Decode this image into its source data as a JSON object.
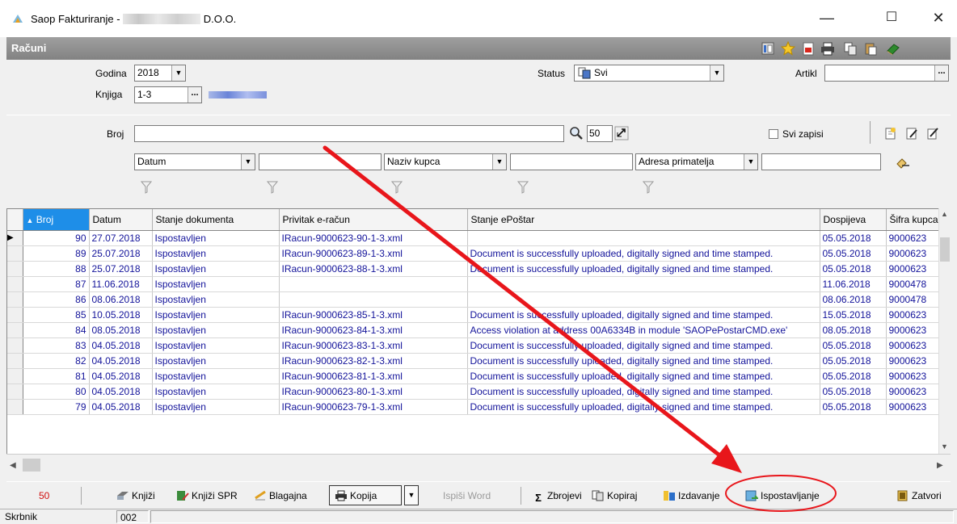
{
  "window": {
    "app_title": "Saop Fakturiranje - ",
    "company_suffix": " D.O.O.",
    "minimize": "—",
    "maximize": "☐",
    "close": "✕"
  },
  "caption": {
    "title": "Računi"
  },
  "filters": {
    "godina_label": "Godina",
    "godina_value": "2018",
    "knjiga_label": "Knjiga",
    "knjiga_value": "1-3",
    "status_label": "Status",
    "status_value": "Svi",
    "artikl_label": "Artikl",
    "artikl_value": "",
    "broj_label": "Broj",
    "broj_value": "",
    "limit_value": "50",
    "svi_zapisi_label": "Svi zapisi",
    "filter1_field": "Datum",
    "filter2_field": "Naziv kupca",
    "filter3_field": "Adresa primatelja"
  },
  "table": {
    "columns": [
      "Broj",
      "Datum",
      "Stanje dokumenta",
      "Privitak e-račun",
      "Stanje ePoštar",
      "Dospijeva",
      "Šifra kupca"
    ],
    "rows": [
      [
        "90",
        "27.07.2018",
        "Ispostavljen",
        "IRacun-9000623-90-1-3.xml",
        "",
        "05.05.2018",
        "9000623"
      ],
      [
        "89",
        "25.07.2018",
        "Ispostavljen",
        "IRacun-9000623-89-1-3.xml",
        "Document is successfully uploaded, digitally signed and time stamped.",
        "05.05.2018",
        "9000623"
      ],
      [
        "88",
        "25.07.2018",
        "Ispostavljen",
        "IRacun-9000623-88-1-3.xml",
        "Document is successfully uploaded, digitally signed and time stamped.",
        "05.05.2018",
        "9000623"
      ],
      [
        "87",
        "11.06.2018",
        "Ispostavljen",
        "",
        "",
        "11.06.2018",
        "9000478"
      ],
      [
        "86",
        "08.06.2018",
        "Ispostavljen",
        "",
        "",
        "08.06.2018",
        "9000478"
      ],
      [
        "85",
        "10.05.2018",
        "Ispostavljen",
        "IRacun-9000623-85-1-3.xml",
        "Document is successfully uploaded, digitally signed and time stamped.",
        "15.05.2018",
        "9000623"
      ],
      [
        "84",
        "08.05.2018",
        "Ispostavljen",
        "IRacun-9000623-84-1-3.xml",
        "Access violation at address 00A6334B in module 'SAOPePostarCMD.exe'",
        "08.05.2018",
        "9000623"
      ],
      [
        "83",
        "04.05.2018",
        "Ispostavljen",
        "IRacun-9000623-83-1-3.xml",
        "Document is successfully uploaded, digitally signed and time stamped.",
        "05.05.2018",
        "9000623"
      ],
      [
        "82",
        "04.05.2018",
        "Ispostavljen",
        "IRacun-9000623-82-1-3.xml",
        "Document is successfully uploaded, digitally signed and time stamped.",
        "05.05.2018",
        "9000623"
      ],
      [
        "81",
        "04.05.2018",
        "Ispostavljen",
        "IRacun-9000623-81-1-3.xml",
        "Document is successfully uploaded, digitally signed and time stamped.",
        "05.05.2018",
        "9000623"
      ],
      [
        "80",
        "04.05.2018",
        "Ispostavljen",
        "IRacun-9000623-80-1-3.xml",
        "Document is successfully uploaded, digitally signed and time stamped.",
        "05.05.2018",
        "9000623"
      ],
      [
        "79",
        "04.05.2018",
        "Ispostavljen",
        "IRacun-9000623-79-1-3.xml",
        "Document is successfully uploaded, digitally signed and time stamped.",
        "05.05.2018",
        "9000623"
      ]
    ]
  },
  "toolbar": {
    "count": "50",
    "knjizi": "Knjiži",
    "knjizi_spr": "Knjiži SPR",
    "blagajna": "Blagajna",
    "kopija": "Kopija",
    "ispisi_word": "Ispiši Word",
    "zbrojevi": "Zbrojevi",
    "kopiraj": "Kopiraj",
    "izdavanje": "Izdavanje",
    "ispostavljanje": "Ispostavljanje",
    "zatvori": "Zatvori"
  },
  "statusbar": {
    "user": "Skrbnik",
    "code": "002"
  },
  "colors": {
    "annotation": "#e8161b",
    "sort_header": "#1e8ee8",
    "link_text": "#13139a"
  }
}
